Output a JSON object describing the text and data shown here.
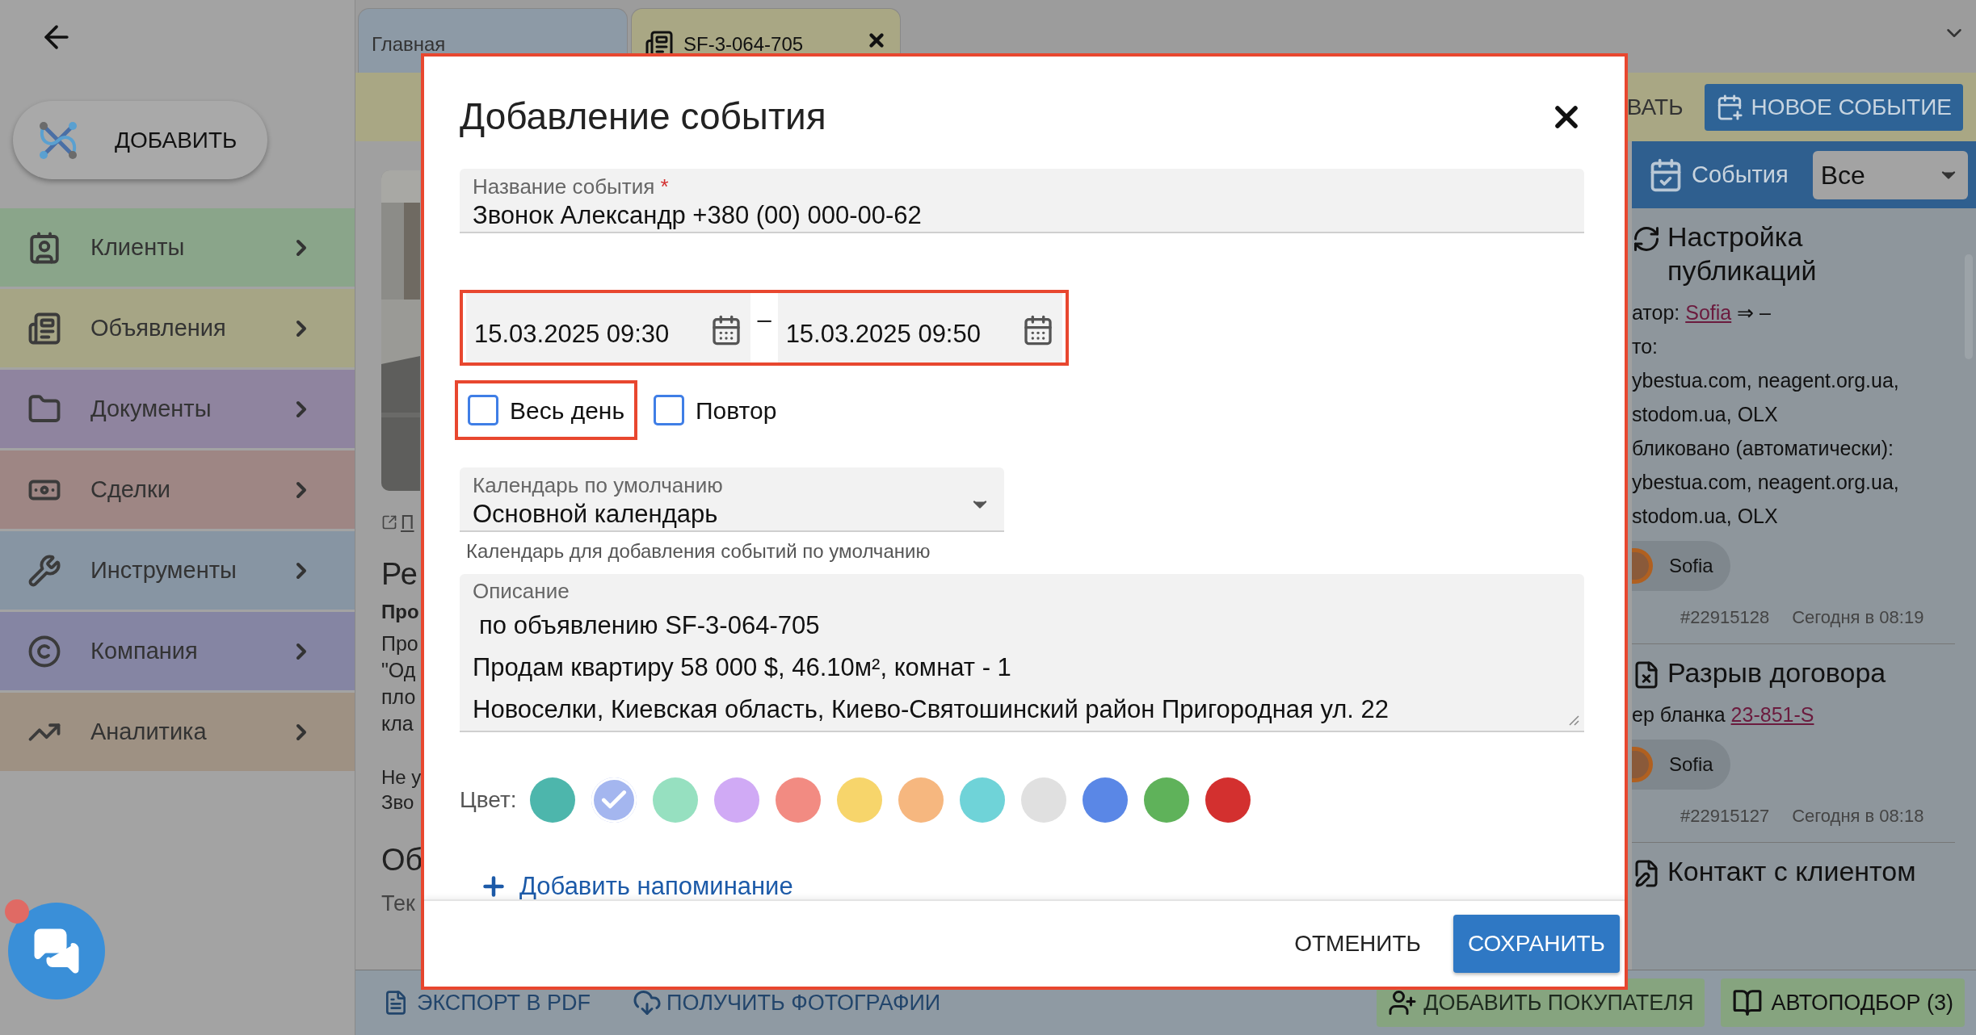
{
  "sidebar": {
    "add_button": "ДОБАВИТЬ",
    "items": [
      {
        "label": "Клиенты",
        "color": "#8aa58a"
      },
      {
        "label": "Объявления",
        "color": "#a6a585"
      },
      {
        "label": "Документы",
        "color": "#8f849f"
      },
      {
        "label": "Сделки",
        "color": "#9e8684"
      },
      {
        "label": "Инструменты",
        "color": "#8795a3"
      },
      {
        "label": "Компания",
        "color": "#8585a3"
      },
      {
        "label": "Аналитика",
        "color": "#9e9183"
      }
    ],
    "chat": {
      "unread": true
    }
  },
  "tabs": [
    {
      "label": "Главная",
      "selected": false,
      "closable": false
    },
    {
      "label": "SF-3-064-705",
      "selected": true,
      "closable": true
    }
  ],
  "toolbar": {
    "partial_button": "ВАТЬ",
    "new_event_button": "НОВОЕ СОБЫТИЕ"
  },
  "listing": {
    "link": "П",
    "heading": "Ре",
    "subheading": "Про",
    "paragraph_lines": [
      "Про",
      "\"Од",
      "пло",
      "кла"
    ],
    "note_lines": [
      "Не у",
      "Зво"
    ],
    "heading_2": "Об",
    "caption": "Тек"
  },
  "events_panel": {
    "title": "События",
    "filter": "Все",
    "events": [
      {
        "kind": "publishing",
        "title": "Настройка публикаций",
        "lines": [
          {
            "text": "атор: ",
            "link": "Sofia",
            "tail": " ⇒ –"
          },
          {
            "text": "то:"
          },
          {
            "text": "ybestua.com, neagent.org.ua,"
          },
          {
            "text": "stodom.ua, OLX"
          },
          {
            "text": "бликовано (автоматически):"
          },
          {
            "text": "ybestua.com, neagent.org.ua,"
          },
          {
            "text": "stodom.ua, OLX"
          }
        ],
        "user": "Sofia",
        "id": "#22915128",
        "time": "Сегодня в 08:19"
      },
      {
        "kind": "termination",
        "title": "Разрыв договора",
        "lines": [
          {
            "text": "ер бланка ",
            "link": "23-851-S"
          }
        ],
        "user": "Sofia",
        "id": "#22915127",
        "time": "Сегодня в 08:18"
      },
      {
        "kind": "contact",
        "title": "Контакт с клиентом"
      }
    ]
  },
  "bottom_bar": {
    "export_pdf": "ЭКСПОРТ В PDF",
    "get_photos": "ПОЛУЧИТЬ ФОТОГРАФИИ",
    "add_buyer": "ДОБАВИТЬ ПОКУПАТЕЛЯ",
    "autoselect": "АВТОПОДБОР (3)"
  },
  "dialog": {
    "highlighted": true,
    "title": "Добавление события",
    "name_field": {
      "label": "Название события",
      "required_mark": "*",
      "value": "Звонок Александр +380 (00) 000-00-62"
    },
    "dates_highlighted": true,
    "start": "15.03.2025 09:30",
    "separator": "–",
    "end": "15.03.2025 09:50",
    "options": [
      {
        "label": "Весь день",
        "checked": false,
        "highlighted": true
      },
      {
        "label": "Повтор",
        "checked": false,
        "highlighted": false
      }
    ],
    "calendar": {
      "label": "Календарь по умолчанию",
      "value": "Основной календарь",
      "helper": "Календарь для добавления событий по умолчанию"
    },
    "description": {
      "label": "Описание",
      "lines": [
        "по объявлению SF-3-064-705",
        "Продам квартиру 58 000 $, 46.10м², комнат - 1",
        "Новоселки, Киевская область, Киево-Святошинский район Пригородная ул. 22"
      ]
    },
    "color_label": "Цвет:",
    "colors": [
      {
        "color": "#4db6ac",
        "selected": false
      },
      {
        "color": "#a4b6ef",
        "selected": true
      },
      {
        "color": "#96e0c0",
        "selected": false
      },
      {
        "color": "#d0aaf5",
        "selected": false
      },
      {
        "color": "#f28b82",
        "selected": false
      },
      {
        "color": "#f7d56b",
        "selected": false
      },
      {
        "color": "#f6b77f",
        "selected": false
      },
      {
        "color": "#6fd3d8",
        "selected": false
      },
      {
        "color": "#e0e0e0",
        "selected": false
      },
      {
        "color": "#5a87e6",
        "selected": false
      },
      {
        "color": "#5fb25a",
        "selected": false
      },
      {
        "color": "#d3302f",
        "selected": false
      }
    ],
    "reminder": "Добавить напоминание",
    "cancel": "ОТМЕНИТЬ",
    "save": "СОХРАНИТЬ"
  }
}
